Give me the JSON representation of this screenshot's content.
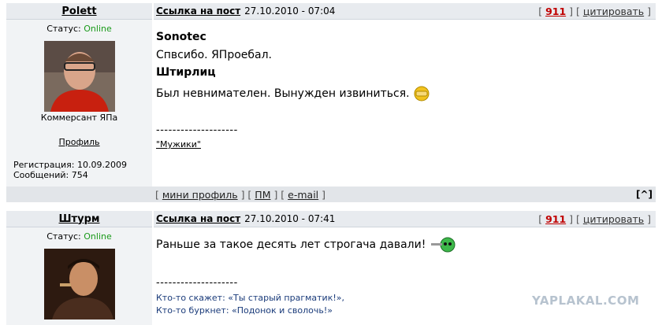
{
  "post1": {
    "author": "Polett",
    "status_label": "Статус:",
    "status_value": "Online",
    "avatar_caption": "Коммерсант ЯПа",
    "profile_link": "Профиль",
    "registration": "Регистрация: 10.09.2009",
    "messages": "Сообщений: 754",
    "post_link": "Ссылка на пост",
    "date": "27.10.2010 - 07:04",
    "rating": "911",
    "quote_label": "цитировать",
    "lines": {
      "l1": "Sonotec",
      "l2": "Спвсибо. ЯПроебал.",
      "l3": "Штирлиц",
      "l4": "Был невнимателен. Вынужден извиниться."
    },
    "sig_separator": "--------------------",
    "sig_link": "\"Мужики\"",
    "footer": {
      "mini_profile": "мини профиль",
      "pm": "ПМ",
      "email": "e-mail",
      "top": "[^]"
    }
  },
  "post2": {
    "author": "Штурм",
    "status_label": "Статус:",
    "status_value": "Online",
    "post_link": "Ссылка на пост",
    "date": "27.10.2010 - 07:41",
    "rating": "911",
    "quote_label": "цитировать",
    "line1": "Раньше за такое десять лет строгача давали!",
    "sig_separator": "--------------------",
    "quote1": "Кто-то скажет: «Ты старый прагматик!»,",
    "quote2": "Кто-то буркнет: «Подонок и сволочь!»"
  },
  "watermark": "YAPLAKAL.COM"
}
